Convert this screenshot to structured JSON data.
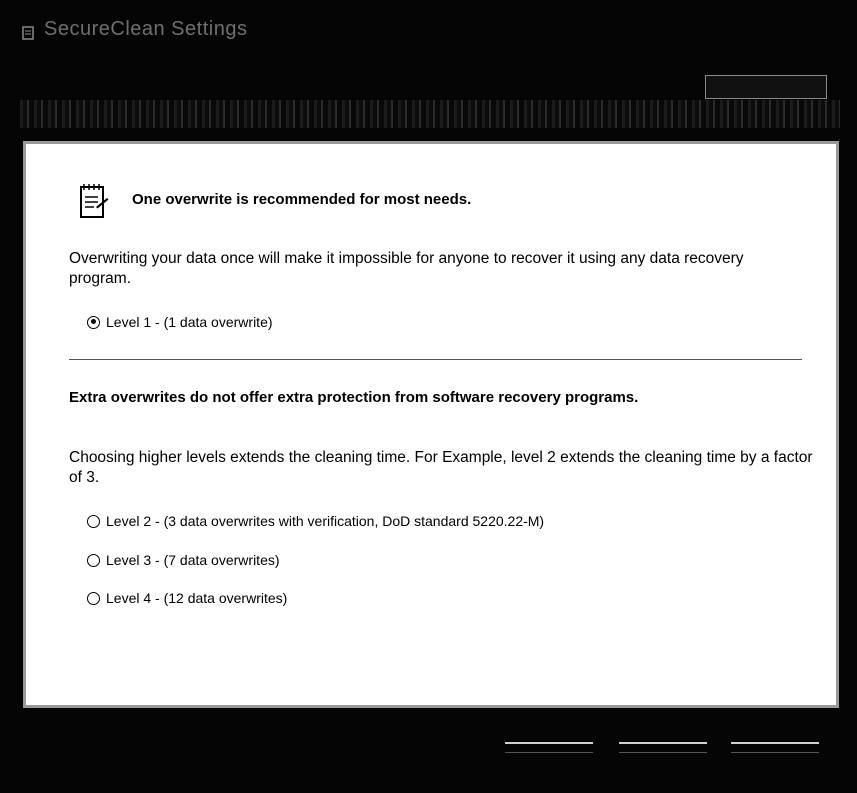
{
  "window": {
    "title": "SecureClean Settings"
  },
  "subheader": {
    "text": "",
    "help_label": ""
  },
  "panel": {
    "recommend_heading": "One overwrite is recommended for most needs.",
    "recommend_text": "Overwriting your data once will make it impossible for anyone to recover it using any data recovery program.",
    "extra_heading": "Extra overwrites do not offer extra protection from software recovery programs.",
    "extra_text": "Choosing higher levels extends the cleaning time.  For Example, level 2 extends the cleaning time by a factor of 3.",
    "levels": [
      {
        "label": "Level 1 - (1 data overwrite)",
        "checked": true
      },
      {
        "label": "Level 2 - (3 data overwrites with verification, DoD standard 5220.22-M)",
        "checked": false
      },
      {
        "label": "Level 3 - (7 data overwrites)",
        "checked": false
      },
      {
        "label": "Level 4 - (12 data overwrites)",
        "checked": false
      }
    ]
  },
  "icons": {
    "app": "app-icon",
    "note": "notepad-icon"
  }
}
